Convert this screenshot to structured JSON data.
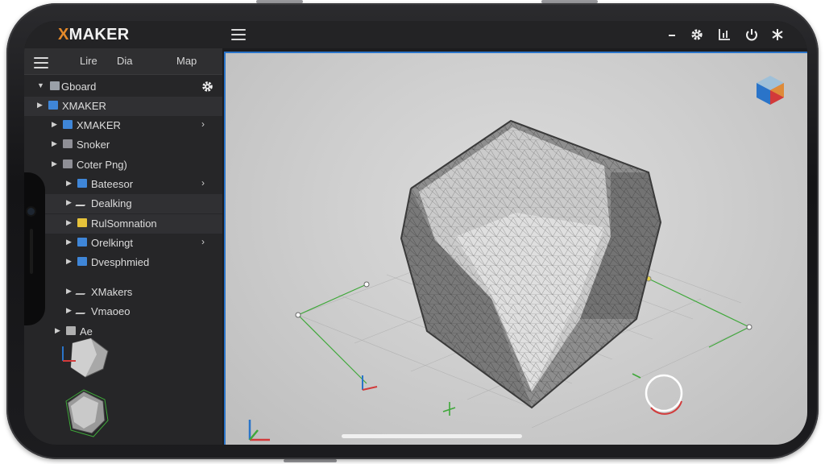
{
  "app": {
    "logo_x": "X",
    "logo_rest": "MAKER"
  },
  "menu": {
    "items": [
      "Lire",
      "Dia",
      "Map"
    ]
  },
  "tree": {
    "root": "Gboard",
    "items": [
      {
        "label": "XMAKER",
        "icon": "folder-icon",
        "has_chevron": false
      },
      {
        "label": "XMAKER",
        "icon": "folder-icon",
        "has_chevron": true
      },
      {
        "label": "Snoker",
        "icon": "cube-icon",
        "has_chevron": false
      },
      {
        "label": "Coter Png)",
        "icon": "cube-icon",
        "has_chevron": false
      },
      {
        "label": "Bateesor",
        "icon": "folder-icon",
        "has_chevron": true
      },
      {
        "label": "Dealking",
        "icon": "wrench-icon",
        "has_chevron": false
      },
      {
        "label": "RulSomnation",
        "icon": "folder-yellow-icon",
        "has_chevron": false
      },
      {
        "label": "Orelkingt",
        "icon": "folder-icon",
        "has_chevron": true
      },
      {
        "label": "Dvesphmied",
        "icon": "folder-icon",
        "has_chevron": false
      },
      {
        "label": "XMakers",
        "icon": "tools-icon",
        "has_chevron": false
      },
      {
        "label": "Vmaoeo",
        "icon": "person-icon",
        "has_chevron": false
      },
      {
        "label": "Ae",
        "icon": "box-icon",
        "has_chevron": false
      }
    ]
  },
  "toolbar": {
    "icons": [
      "collapse-icon",
      "gear-icon",
      "chart-icon",
      "power-icon",
      "snowflake-icon"
    ]
  },
  "colors": {
    "accent": "#2a74c9",
    "logo_accent": "#e58a2a",
    "grid_green": "#3fa83a",
    "folder_blue": "#3f86d8",
    "folder_yellow": "#e6c23a"
  }
}
